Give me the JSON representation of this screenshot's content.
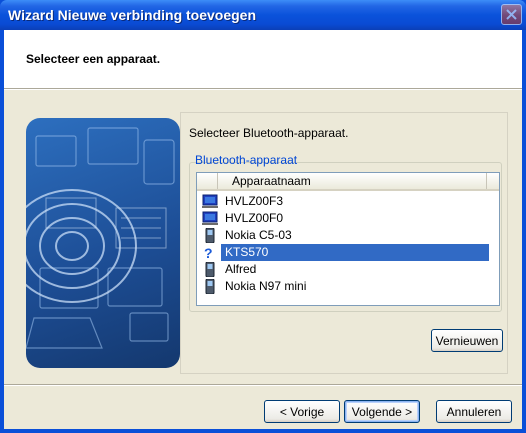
{
  "window": {
    "title": "Wizard Nieuwe verbinding toevoegen",
    "close_icon": "close-icon"
  },
  "header": {
    "title": "Selecteer een apparaat."
  },
  "panel": {
    "instruction": "Selecteer Bluetooth-apparaat.",
    "group_title": "Bluetooth-apparaat",
    "column_header": "Apparaatnaam",
    "devices": [
      {
        "name": "HVLZ00F3",
        "icon": "computer-icon",
        "selected": false
      },
      {
        "name": "HVLZ00F0",
        "icon": "computer-icon",
        "selected": false
      },
      {
        "name": "Nokia C5-03",
        "icon": "phone-icon",
        "selected": false
      },
      {
        "name": "KTS570",
        "icon": "unknown-device-icon",
        "selected": true
      },
      {
        "name": "Alfred",
        "icon": "phone-icon",
        "selected": false
      },
      {
        "name": "Nokia N97 mini",
        "icon": "phone-icon",
        "selected": false
      }
    ],
    "refresh_label": "Vernieuwen"
  },
  "footer": {
    "back_label": "< Vorige",
    "next_label": "Volgende >",
    "cancel_label": "Annuleren"
  },
  "colors": {
    "titlebar": "#0a52db",
    "selection": "#316ac5",
    "group_title": "#0046d5"
  }
}
